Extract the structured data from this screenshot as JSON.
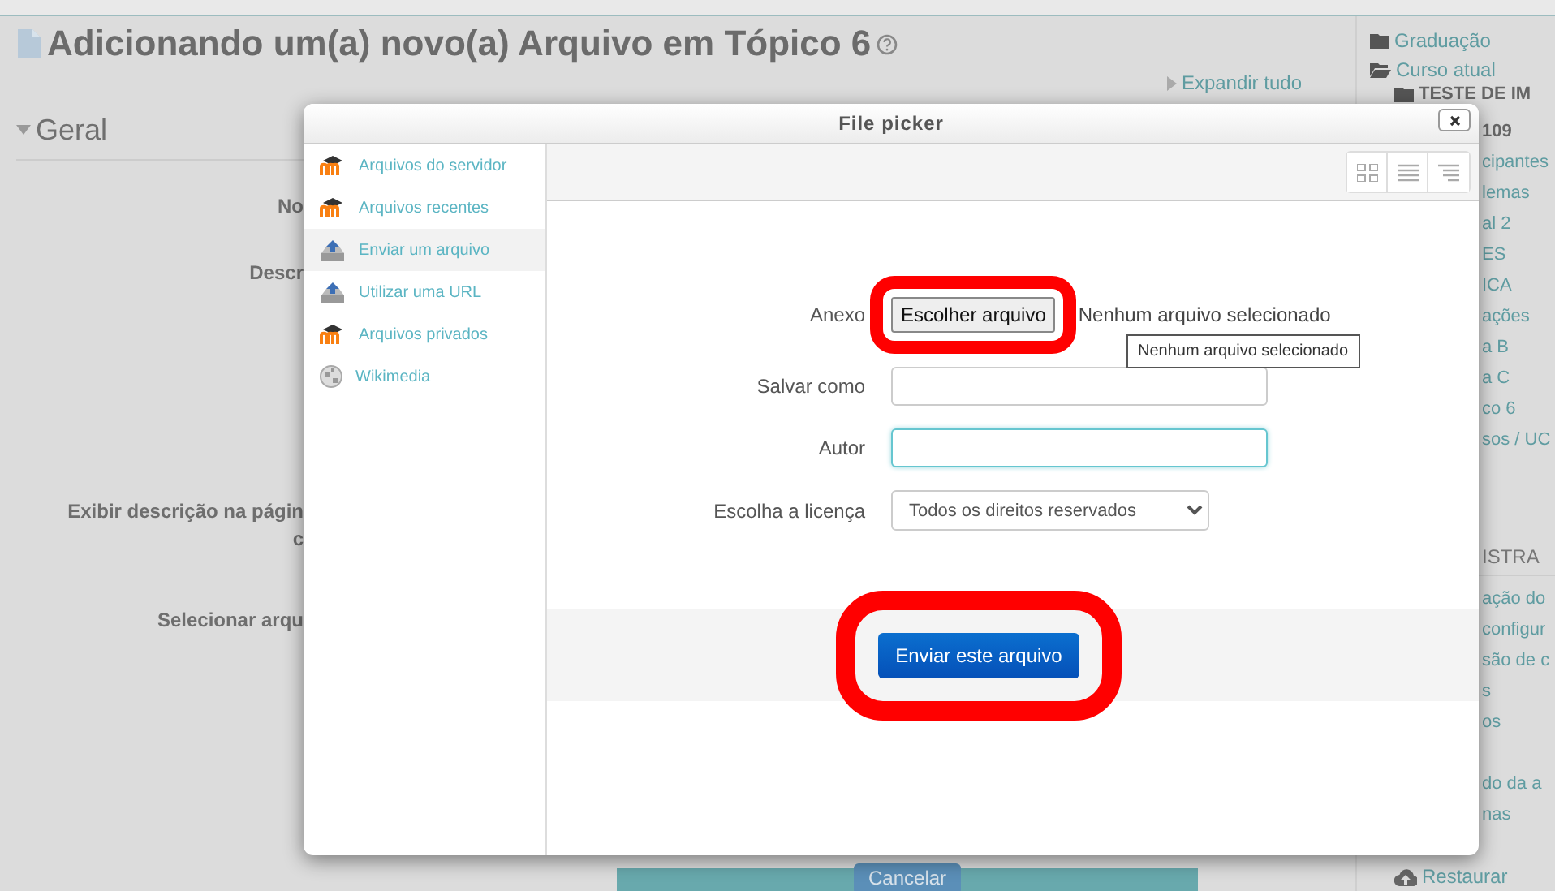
{
  "page": {
    "title": "Adicionando um(a) novo(a) Arquivo em Tópico 6",
    "expand_all": "Expandir tudo",
    "section": "Geral",
    "form_labels": [
      "No",
      "Descr",
      "Exibir descrição na págin",
      "c",
      "Selecionar arqu"
    ],
    "cancel_button": "Cancelar"
  },
  "sidebar": {
    "nav_items": [
      {
        "label": "Graduação",
        "kind": "folder"
      },
      {
        "label": "Curso atual",
        "kind": "folder-open"
      },
      {
        "label": "TESTE DE IM",
        "kind": "course"
      }
    ],
    "nav_partial": [
      {
        "label": "109",
        "kind": "course"
      },
      {
        "label": "cipantes",
        "kind": "link"
      },
      {
        "label": "lemas",
        "kind": "link"
      },
      {
        "label": "al 2",
        "kind": "link"
      },
      {
        "label": "ES",
        "kind": "link"
      },
      {
        "label": "ICA",
        "kind": "link"
      },
      {
        "label": "ações",
        "kind": "link"
      },
      {
        "label": "a B",
        "kind": "link"
      },
      {
        "label": "a C",
        "kind": "link"
      },
      {
        "label": "co 6",
        "kind": "link"
      },
      {
        "label": "sos / UC",
        "kind": "link"
      }
    ],
    "admin_heading": "ISTRA",
    "admin_items": [
      "ação do",
      "configur",
      "são de c",
      "s",
      "os"
    ],
    "admin_items_2": [
      "do da a",
      "nas"
    ],
    "restore": "Restaurar"
  },
  "dialog": {
    "title": "File picker",
    "repositories": [
      {
        "label": "Arquivos do servidor",
        "kind": "moodle",
        "selected": false
      },
      {
        "label": "Arquivos recentes",
        "kind": "moodle",
        "selected": false
      },
      {
        "label": "Enviar um arquivo",
        "kind": "upload",
        "selected": true
      },
      {
        "label": "Utilizar uma URL",
        "kind": "upload",
        "selected": false
      },
      {
        "label": "Arquivos privados",
        "kind": "moodle",
        "selected": false
      },
      {
        "label": "Wikimedia",
        "kind": "globe",
        "selected": false
      }
    ],
    "view_buttons": [
      {
        "kind": "icons"
      },
      {
        "kind": "list"
      },
      {
        "kind": "tree"
      }
    ],
    "fields": [
      {
        "label": "Anexo",
        "kind": "file",
        "button": "Escolher arquivo",
        "value": "Nenhum arquivo selecionado",
        "tooltip": "Nenhum arquivo selecionado",
        "highlighted": true
      },
      {
        "label": "Salvar como",
        "kind": "text",
        "focused": false
      },
      {
        "label": "Autor",
        "kind": "text",
        "focused": true
      },
      {
        "label": "Escolha a licença",
        "kind": "select",
        "value": "Todos os direitos reservados"
      }
    ],
    "submit": {
      "label": "Enviar este arquivo",
      "highlighted": true
    }
  }
}
